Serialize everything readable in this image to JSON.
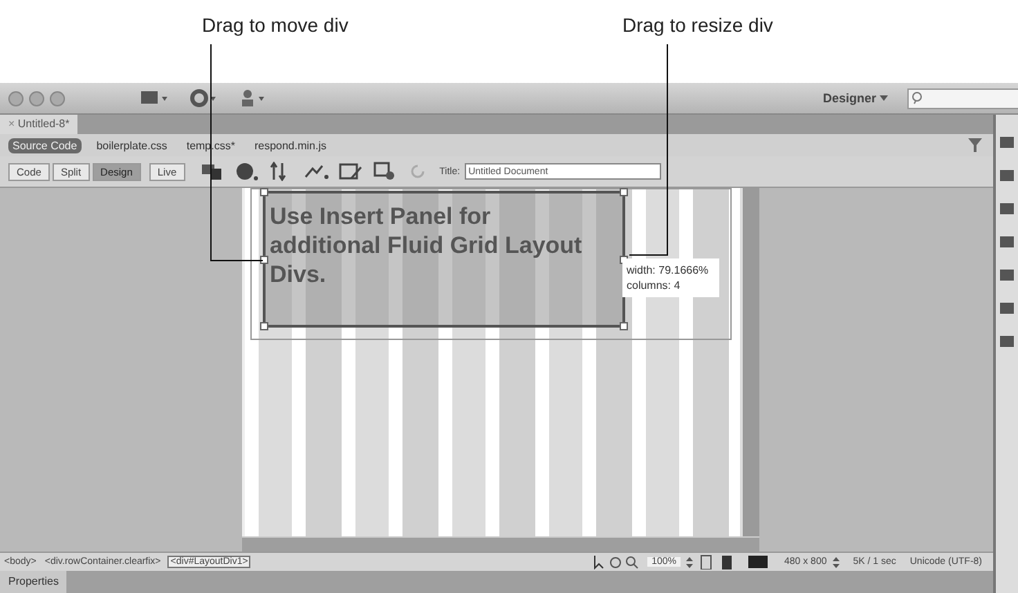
{
  "callouts": [
    {
      "text": "Drag to move div"
    },
    {
      "text": "Drag to resize div"
    }
  ],
  "title_bar": {
    "workspace": "Designer"
  },
  "document_tab": {
    "label": "Untitled-8*",
    "close": "×"
  },
  "related_files": [
    {
      "label": "Source Code",
      "selected": true
    },
    {
      "label": "boilerplate.css",
      "selected": false
    },
    {
      "label": "temp.css*",
      "selected": false
    },
    {
      "label": "respond.min.js",
      "selected": false
    }
  ],
  "view_buttons": [
    {
      "label": "Code",
      "selected": false
    },
    {
      "label": "Split",
      "selected": false
    },
    {
      "label": "Design",
      "selected": true
    },
    {
      "label": "Live",
      "selected": false
    }
  ],
  "title_field": {
    "label": "Title:",
    "value": "Untitled Document"
  },
  "fluid_div": {
    "text": "Use Insert Panel for additional Fluid Grid Layout Divs.",
    "selected": true
  },
  "tooltip": {
    "lines": [
      "width: 79.1666%",
      "columns: 4"
    ]
  },
  "tag_selector": [
    {
      "label": "<body>",
      "selected": false
    },
    {
      "label": "<div.rowContainer.clearfix>",
      "selected": false
    },
    {
      "label": "<div#LayoutDiv1>",
      "selected": true
    }
  ],
  "status_bar": {
    "zoom": "100%",
    "window_size": "480 x 800",
    "download": "5K / 1 sec",
    "encoding": "Unicode (UTF-8)"
  },
  "panel_tab": "Properties"
}
